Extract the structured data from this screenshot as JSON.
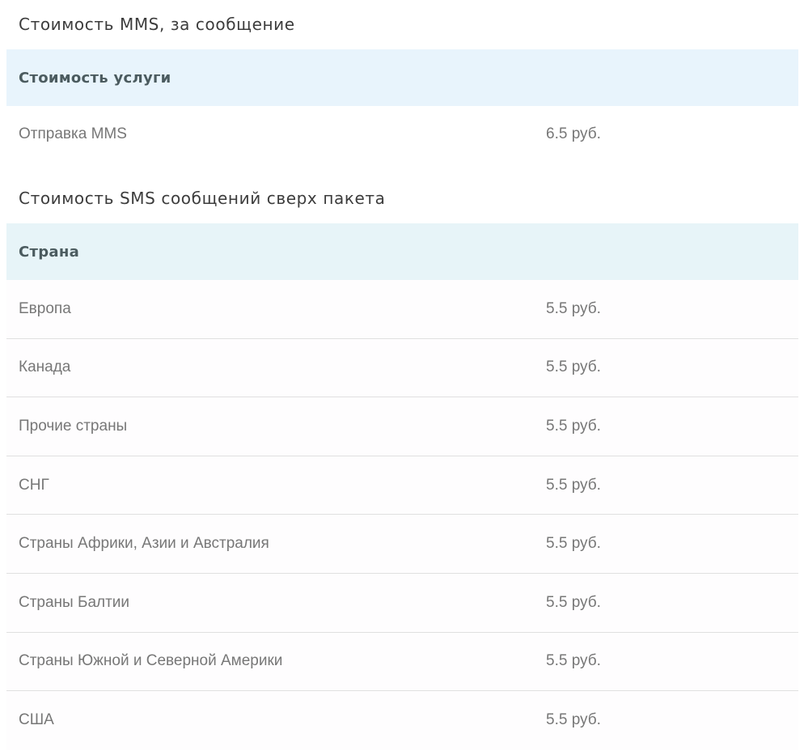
{
  "mms": {
    "title": "Стоимость MMS, за сообщение",
    "header": "Стоимость услуги",
    "rows": [
      {
        "name": "Отправка MMS",
        "price": "6.5 руб."
      }
    ]
  },
  "sms": {
    "title": "Стоимость SMS сообщений сверх пакета",
    "header": "Страна",
    "rows": [
      {
        "name": "Европа",
        "price": "5.5 руб."
      },
      {
        "name": "Канада",
        "price": "5.5 руб."
      },
      {
        "name": "Прочие страны",
        "price": "5.5 руб."
      },
      {
        "name": "СНГ",
        "price": "5.5 руб."
      },
      {
        "name": "Страны Африки, Азии и Австралия",
        "price": "5.5 руб."
      },
      {
        "name": "Страны Балтии",
        "price": "5.5 руб."
      },
      {
        "name": "Страны Южной и Северной Америки",
        "price": "5.5 руб."
      },
      {
        "name": "США",
        "price": "5.5 руб."
      }
    ]
  }
}
